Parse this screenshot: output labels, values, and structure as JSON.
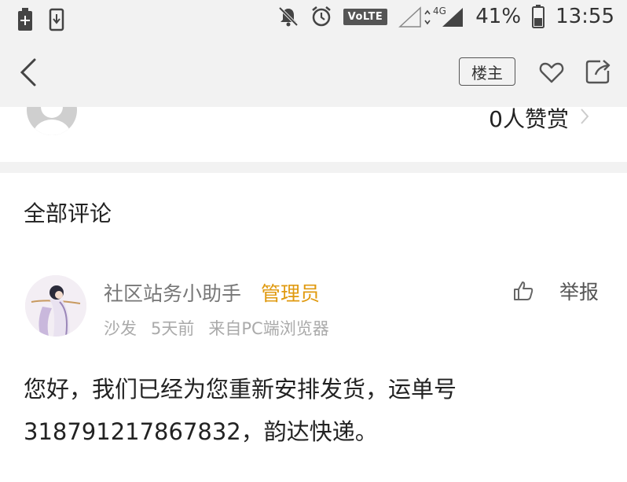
{
  "status_bar": {
    "battery_percent": "41%",
    "time": "13:55",
    "volte_label": "VoLTE",
    "network_label": "4G",
    "icons": [
      "battery-saver-icon",
      "download-icon",
      "mute-icon",
      "alarm-icon",
      "volte-icon",
      "signal-icon",
      "battery-icon"
    ]
  },
  "nav": {
    "louzhu_label": "楼主"
  },
  "donate": {
    "text": "0人赞赏"
  },
  "comments": {
    "title": "全部评论",
    "items": [
      {
        "author": "社区站务小助手",
        "role": "管理员",
        "floor": "沙发",
        "time": "5天前",
        "source": "来自PC端浏览器",
        "report_label": "举报",
        "content_line1": "您好，我们已经为您重新安排发货，运单号",
        "content_line2": "318791217867832，韵达快递。"
      }
    ]
  },
  "colors": {
    "admin_accent": "#e09a10",
    "top_bg": "#f2f2f2",
    "meta_text": "#aaaaaa"
  }
}
